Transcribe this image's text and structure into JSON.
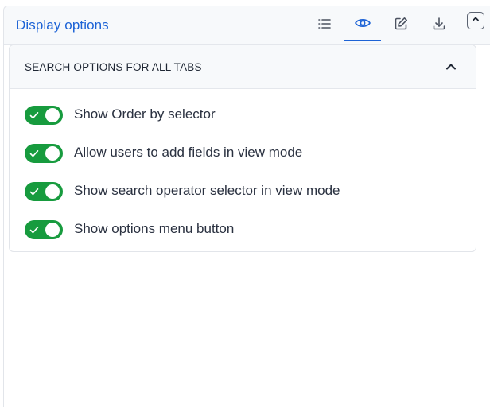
{
  "panel": {
    "title": "Display options",
    "toolbar": [
      {
        "id": "list",
        "icon": "list-icon",
        "active": false
      },
      {
        "id": "view",
        "icon": "eye-icon",
        "active": true
      },
      {
        "id": "edit",
        "icon": "edit-icon",
        "active": false
      },
      {
        "id": "download",
        "icon": "download-icon",
        "active": false
      }
    ],
    "collapse_icon": "chevron-up-icon"
  },
  "section": {
    "title": "SEARCH OPTIONS FOR ALL TABS",
    "expanded": true,
    "options": [
      {
        "label": "Show Order by selector",
        "enabled": true
      },
      {
        "label": "Allow users to add fields in view mode",
        "enabled": true
      },
      {
        "label": "Show search operator selector in view mode",
        "enabled": true
      },
      {
        "label": "Show options menu button",
        "enabled": true
      }
    ]
  },
  "colors": {
    "accent": "#1d63d6",
    "toggle_on": "#179b3e",
    "text": "#2a3140",
    "header_bg": "#f7f9fb",
    "border": "#e2e5ea"
  }
}
